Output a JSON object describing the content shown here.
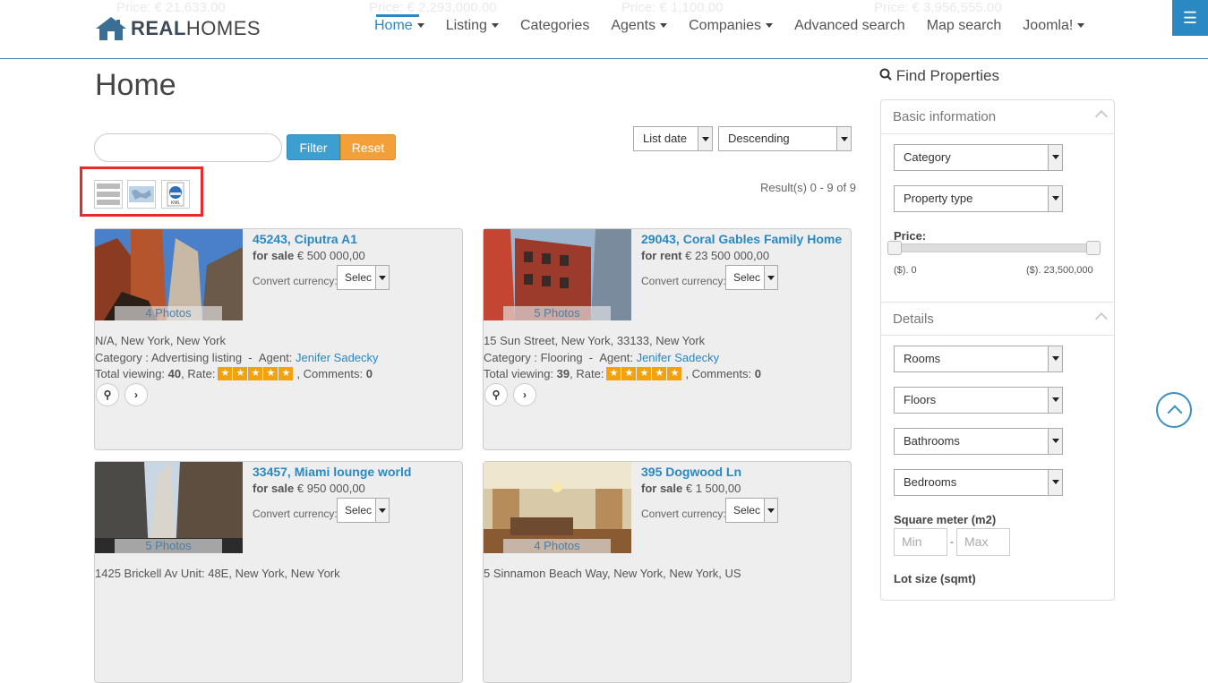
{
  "ticker": [
    "Price: € 21,633.00",
    "Price: € 2,293,000.00",
    "Price: € 1,100.00",
    "Price: € 3,956,555.00"
  ],
  "logo": {
    "bold": "REAL",
    "light": "HOMES"
  },
  "nav": [
    {
      "label": "Home",
      "caret": true
    },
    {
      "label": "Listing",
      "caret": true
    },
    {
      "label": "Categories",
      "caret": false
    },
    {
      "label": "Agents",
      "caret": true
    },
    {
      "label": "Companies",
      "caret": true
    },
    {
      "label": "Advanced search",
      "caret": false
    },
    {
      "label": "Map search",
      "caret": false
    },
    {
      "label": "Joomla!",
      "caret": true
    }
  ],
  "menu_icon": "☰",
  "page": {
    "title": "Home"
  },
  "filter": {
    "value": "",
    "filter_label": "Filter",
    "reset_label": "Reset"
  },
  "sort": {
    "order_by": "List date",
    "direction": "Descending"
  },
  "results": "Result(s) 0 - 9 of 9",
  "view_icons": [
    "list-view-icon",
    "map-view-icon",
    "kml-export-icon"
  ],
  "listings": [
    {
      "title": "45243, Ciputra A1",
      "status": "for sale",
      "price": "€ 500 000,00",
      "convert_label": "Convert currency:",
      "convert_value": "Selec",
      "photos": "4 Photos",
      "address": "N/A, New York, New York",
      "category_label": "Category :",
      "category": "Advertising listing",
      "agent_label": "Agent:",
      "agent": "Jenifer Sadecky",
      "viewing_label": "Total viewing:",
      "viewing": "40",
      "rate_label": ", Rate:",
      "comments_label": ", Comments:",
      "comments": "0",
      "rating": 5
    },
    {
      "title": "29043, Coral Gables Family Home",
      "status": "for rent",
      "price": "€ 23 500 000,00",
      "convert_label": "Convert currency:",
      "convert_value": "Selec",
      "photos": "5 Photos",
      "address": "15 Sun Street, New York, 33133, New York",
      "category_label": "Category :",
      "category": "Flooring",
      "agent_label": "Agent:",
      "agent": "Jenifer Sadecky",
      "viewing_label": "Total viewing:",
      "viewing": "39",
      "rate_label": ", Rate:",
      "comments_label": ", Comments:",
      "comments": "0",
      "rating": 5
    },
    {
      "title": "33457, Miami lounge world",
      "status": "for sale",
      "price": "€ 950 000,00",
      "convert_label": "Convert currency:",
      "convert_value": "Selec",
      "photos": "5 Photos",
      "address": "1425 Brickell Av Unit: 48E, New York, New York"
    },
    {
      "title": "395 Dogwood Ln",
      "status": "for sale",
      "price": "€ 1 500,00",
      "convert_label": "Convert currency:",
      "convert_value": "Selec",
      "photos": "4 Photos",
      "address": "5 Sinnamon Beach Way, New York, New York, US"
    }
  ],
  "sidebar": {
    "title": "Find Properties",
    "basic_header": "Basic information",
    "category": "Category",
    "property_type": "Property type",
    "price_label": "Price:",
    "price_min": "($). 0",
    "price_max": "($). 23,500,000",
    "details_header": "Details",
    "rooms": "Rooms",
    "floors": "Floors",
    "bathrooms": "Bathrooms",
    "bedrooms": "Bedrooms",
    "sqm_label": "Square meter (m2)",
    "min_placeholder": "Min",
    "max_placeholder": "Max",
    "separator": "-",
    "lot_label": "Lot size (sqmt)"
  },
  "colors": {
    "accent": "#2a88c2",
    "filter_btn": "#3d9fd0",
    "reset_btn": "#f3a03a",
    "stars": "#f2a20f",
    "highlight": "#e52b2b"
  }
}
